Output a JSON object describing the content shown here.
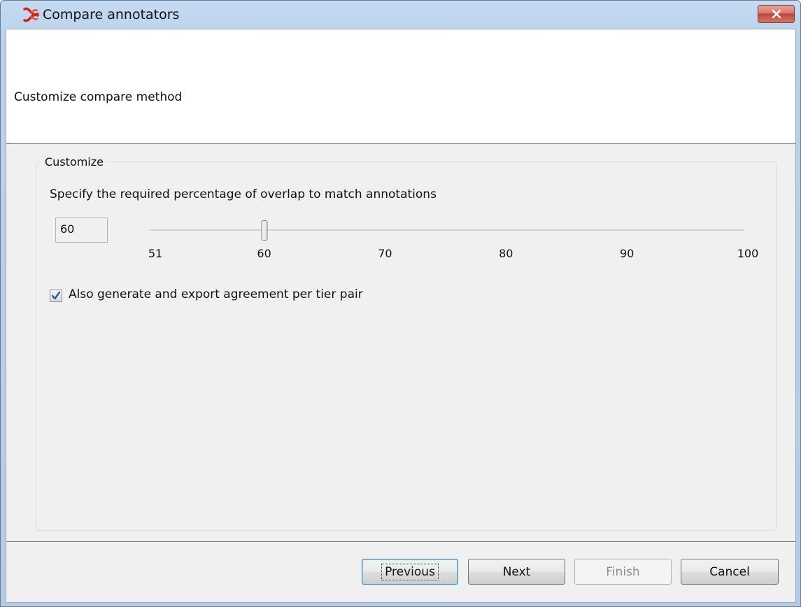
{
  "window": {
    "title": "Compare annotators",
    "close_icon": "close-icon"
  },
  "header": {
    "text": "Customize compare method"
  },
  "customize": {
    "legend": "Customize",
    "overlap_label": "Specify the required percentage of overlap to match annotations",
    "overlap_value": "60",
    "slider": {
      "min": 51,
      "max": 100,
      "value": 60,
      "ticks": [
        "51",
        "60",
        "70",
        "80",
        "90",
        "100"
      ]
    },
    "tier_pair_checkbox": {
      "label": "Also generate and export agreement per tier pair",
      "checked": true
    }
  },
  "buttons": {
    "previous": "Previous",
    "next": "Next",
    "finish": "Finish",
    "cancel": "Cancel"
  },
  "colors": {
    "title_bar": "#b9d1ea",
    "close_button": "#c0443a",
    "check_mark": "#2a56b6"
  }
}
